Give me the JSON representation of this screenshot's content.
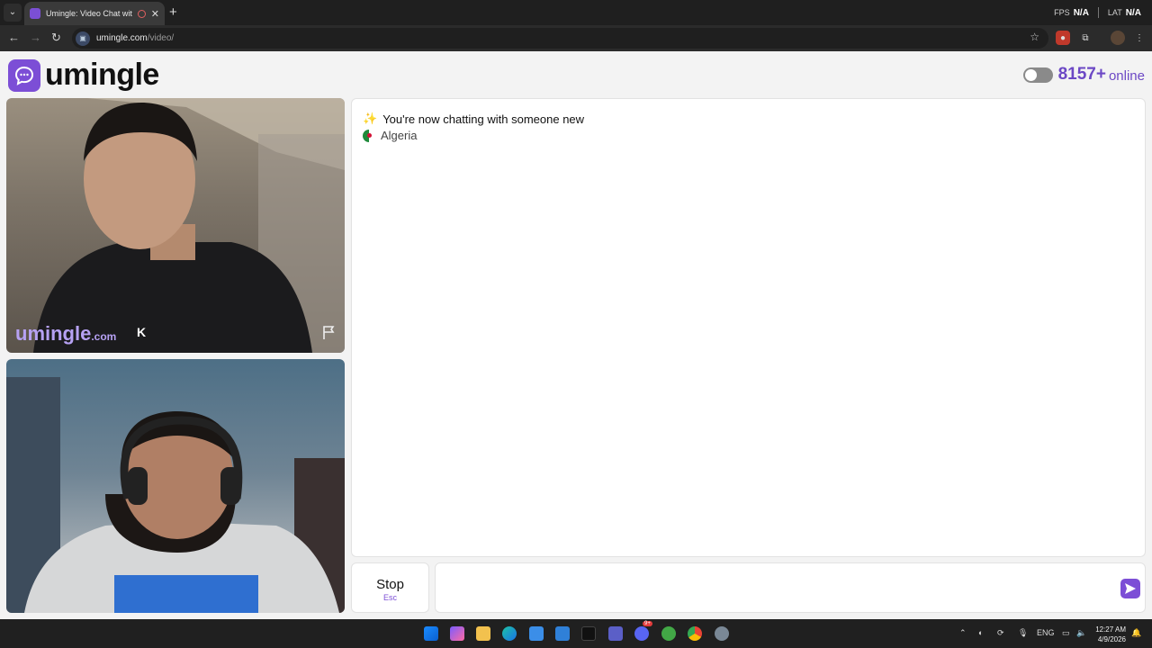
{
  "browser": {
    "tab_title": "Umingle: Video Chat with S",
    "url_domain": "umingle.com",
    "url_path": "/video/",
    "fps_label": "FPS",
    "fps_value": "N/A",
    "lat_label": "LAT",
    "lat_value": "N/A"
  },
  "header": {
    "logo_text": "umingle",
    "online_count": "8157+",
    "online_label": "online"
  },
  "videos": {
    "stranger_brand": "umingle",
    "stranger_brand_suffix": ".com"
  },
  "chat": {
    "status_message": "You're now chatting with someone new",
    "country": "Algeria"
  },
  "controls": {
    "stop_label": "Stop",
    "stop_key": "Esc",
    "message_placeholder": ""
  },
  "taskbar": {
    "language": "ENG",
    "time": "12:27 AM",
    "date": "4/9/2026",
    "discord_badge": "9+"
  },
  "colors": {
    "accent": "#7c4ed6",
    "online_text": "#6c48c5"
  }
}
